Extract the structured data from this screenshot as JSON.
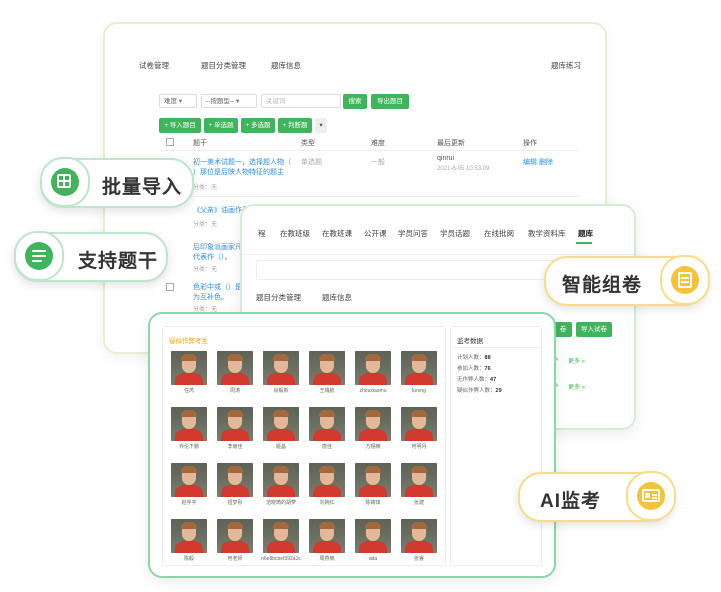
{
  "card_a": {
    "nav": [
      "试卷管理",
      "题目分类管理",
      "题库信息",
      "题库练习"
    ],
    "filters": {
      "difficulty": "难度",
      "type": "--按题型--",
      "keyword_placeholder": "关键词",
      "search": "搜索",
      "export": "导出题目"
    },
    "toolbar": [
      "+ 导入题目",
      "+ 单选题",
      "+ 多选题",
      "+ 判断题"
    ],
    "columns": [
      "题干",
      "类型",
      "难度",
      "最后更新",
      "操作"
    ],
    "rows": [
      {
        "title_line1": "初一美术试题一，选择题人物（",
        "title_line2": "）那位是后映人物特征的题主",
        "category": "分类：无",
        "type": "单选题",
        "difficulty": "一般",
        "updater": "qinrui",
        "updated": "2021-6-05 10:53:09",
        "edit": "编辑",
        "delete": "删除"
      },
      {
        "title_line1": "《父亲》油画作品",
        "title_line2": "",
        "category": "分类：无",
        "type": "",
        "difficulty": "",
        "updater": "",
        "updated": "",
        "edit": "",
        "delete": ""
      },
      {
        "title_line1": "后印象派画家凡高",
        "title_line2": "代表作（）。",
        "category": "分类：无",
        "type": "",
        "difficulty": "",
        "updater": "",
        "updated": "",
        "edit": "",
        "delete": ""
      },
      {
        "title_line1": "色彩中或（）是",
        "title_line2": "为互补色。",
        "category": "分类：无",
        "type": "",
        "difficulty": "",
        "updater": "",
        "updated": "",
        "edit": "",
        "delete": ""
      }
    ]
  },
  "card_b": {
    "nav": [
      "程",
      "在教班级",
      "在教班课",
      "公开课",
      "学员问答",
      "学员话题",
      "在线批阅",
      "教学资料库",
      "题库"
    ],
    "sub_nav": [
      "题目分类管理",
      "题库信息"
    ],
    "buttons": [
      "卷",
      "导入试卷"
    ],
    "more": "更多 »"
  },
  "card_c": {
    "title": "疑似作弊考生",
    "side_title": "监考数据",
    "stats": [
      {
        "label": "计划人数：",
        "value": "88"
      },
      {
        "label": "参加人数：",
        "value": "76"
      },
      {
        "label": "无作弊人数：",
        "value": "47"
      },
      {
        "label": "疑似作弊人数：",
        "value": "29"
      }
    ],
    "students": [
      "任芮",
      "周涛",
      "肖毅新",
      "王瑞航",
      "zhouxiaomu",
      "lurong",
      "乔伦下鹏",
      "李雨佳",
      "姬晶",
      "唐佳",
      "万翔楠",
      "何明月",
      "赵伴宇",
      "钮梦彤",
      "范晓琦的胡萝",
      "刘婉红",
      "陈婧琪",
      "张建",
      "陈毅",
      "何老师",
      "n6e8bcbef392a1c",
      "周燕楠",
      "ada",
      "张睿"
    ]
  },
  "features": {
    "batch_import": "批量导入",
    "stem_support": "支持题干",
    "smart_paper": "智能组卷",
    "ai_proctor": "AI监考"
  },
  "colors": {
    "accent_green": "#3fb45b",
    "accent_yellow": "#f4c33a",
    "link_blue": "#2c8ee6"
  }
}
